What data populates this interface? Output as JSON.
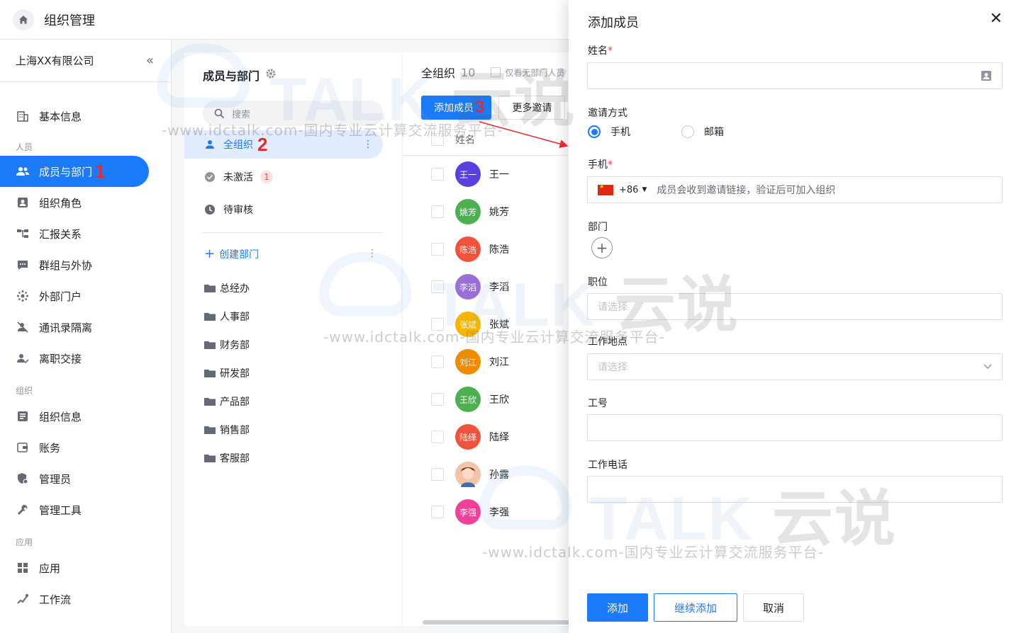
{
  "topbar": {
    "title": "组织管理"
  },
  "sidebar": {
    "company": "上海XX有限公司",
    "items": [
      {
        "label": "基本信息",
        "group": null
      },
      {
        "label": "成员与部门"
      },
      {
        "label": "组织角色"
      },
      {
        "label": "汇报关系"
      },
      {
        "label": "群组与外协"
      },
      {
        "label": "外部门户"
      },
      {
        "label": "通讯录隔离"
      },
      {
        "label": "离职交接"
      },
      {
        "label": "组织信息"
      },
      {
        "label": "账务"
      },
      {
        "label": "管理员"
      },
      {
        "label": "管理工具"
      },
      {
        "label": "应用"
      },
      {
        "label": "工作流"
      }
    ],
    "groups": {
      "people": "人员",
      "org": "组织",
      "apps": "应用"
    }
  },
  "annotations": {
    "a1": "1",
    "a2": "2",
    "a3": "3"
  },
  "dept_panel": {
    "title": "成员与部门",
    "search_placeholder": "搜索",
    "filters": [
      {
        "label": "全组织"
      },
      {
        "label": "未激活",
        "badge": "1"
      },
      {
        "label": "待审核"
      }
    ],
    "create_label": "创建部门",
    "departments": [
      "总经办",
      "人事部",
      "财务部",
      "研发部",
      "产品部",
      "销售部",
      "客服部"
    ]
  },
  "member_panel": {
    "title": "全组织",
    "count": "10",
    "only_no_dept": "仅看无部门人员",
    "add_button": "添加成员",
    "more_invite": "更多邀请",
    "col_name": "姓名",
    "members": [
      {
        "name": "王一",
        "avatar": "王一",
        "color": "#5b3fe0"
      },
      {
        "name": "姚芳",
        "avatar": "姚芳",
        "color": "#4caf50"
      },
      {
        "name": "陈浩",
        "avatar": "陈浩",
        "color": "#f0533b"
      },
      {
        "name": "李滔",
        "avatar": "李滔",
        "color": "#9b6dd6"
      },
      {
        "name": "张斌",
        "avatar": "张斌",
        "color": "#f7b500"
      },
      {
        "name": "刘江",
        "avatar": "刘江",
        "color": "#f08a00"
      },
      {
        "name": "王欣",
        "avatar": "王欣",
        "color": "#4caf50"
      },
      {
        "name": "陆绎",
        "avatar": "陆绎",
        "color": "#f0533b"
      },
      {
        "name": "孙露",
        "avatar": "",
        "color": "#f4c4a8"
      },
      {
        "name": "李强",
        "avatar": "李强",
        "color": "#f0409a"
      }
    ]
  },
  "drawer": {
    "title": "添加成员",
    "name_label": "姓名",
    "invite_label": "邀请方式",
    "invite_phone": "手机",
    "invite_email": "邮箱",
    "phone_label": "手机",
    "phone_code": "+86",
    "phone_placeholder": "成员会收到邀请链接，验证后可加入组织",
    "dept_label": "部门",
    "position_label": "职位",
    "position_placeholder": "请选择",
    "location_label": "工作地点",
    "location_placeholder": "请选择",
    "employee_no_label": "工号",
    "work_phone_label": "工作电话",
    "btn_add": "添加",
    "btn_continue": "继续添加",
    "btn_cancel": "取消",
    "required_mark": "*"
  },
  "watermark": {
    "brand": "TALK",
    "brand_cn": "云说",
    "tagline": "-www.idctalk.com-国内专业云计算交流服务平台-"
  },
  "colors": {
    "accent": "#1a7af8",
    "annotation": "#e8282b"
  }
}
